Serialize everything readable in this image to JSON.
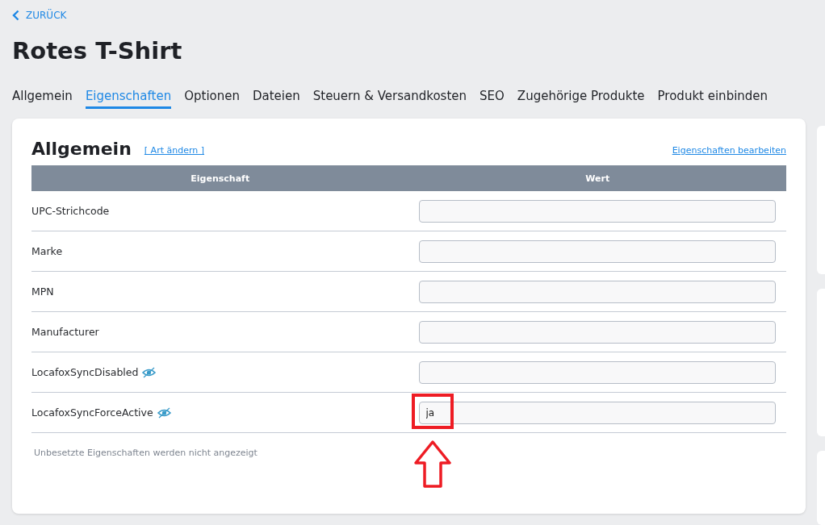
{
  "back_link": "ZURÜCK",
  "title": "Rotes T-Shirt",
  "tabs": [
    {
      "label": "Allgemein",
      "selected": false
    },
    {
      "label": "Eigenschaften",
      "selected": true
    },
    {
      "label": "Optionen",
      "selected": false
    },
    {
      "label": "Dateien",
      "selected": false
    },
    {
      "label": "Steuern & Versandkosten",
      "selected": false
    },
    {
      "label": "SEO",
      "selected": false
    },
    {
      "label": "Zugehörige Produkte",
      "selected": false
    },
    {
      "label": "Produkt einbinden",
      "selected": false
    }
  ],
  "card": {
    "title": "Allgemein",
    "change_type_link": "[ Art ändern ]",
    "edit_link": "Eigenschaften bearbeiten",
    "columns": [
      "Eigenschaft",
      "Wert"
    ],
    "rows": [
      {
        "name": "UPC-Strichcode",
        "value": "",
        "hidden": false,
        "highlighted": false
      },
      {
        "name": "Marke",
        "value": "",
        "hidden": false,
        "highlighted": false
      },
      {
        "name": "MPN",
        "value": "",
        "hidden": false,
        "highlighted": false
      },
      {
        "name": "Manufacturer",
        "value": "",
        "hidden": false,
        "highlighted": false
      },
      {
        "name": "LocafoxSyncDisabled",
        "value": "",
        "hidden": true,
        "highlighted": false
      },
      {
        "name": "LocafoxSyncForceActive",
        "value": "ja",
        "hidden": true,
        "highlighted": true
      }
    ],
    "note": "Unbesetzte Eigenschaften werden nicht angezeigt"
  }
}
